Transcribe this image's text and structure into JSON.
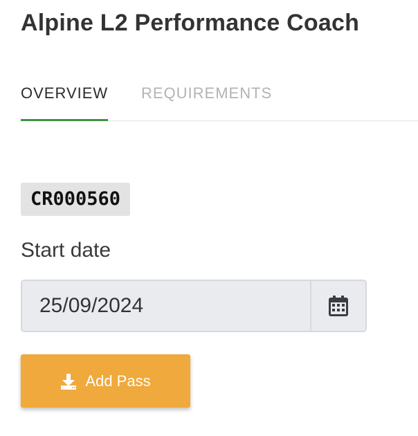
{
  "page": {
    "title": "Alpine L2 Performance Coach"
  },
  "tabs": [
    {
      "label": "OVERVIEW",
      "active": true
    },
    {
      "label": "REQUIREMENTS",
      "active": false
    }
  ],
  "course": {
    "code": "CR000560"
  },
  "start_date": {
    "label": "Start date",
    "value": "25/09/2024",
    "icon": "calendar-icon"
  },
  "actions": {
    "add_pass_label": "Add Pass",
    "add_pass_icon": "download-icon"
  },
  "colors": {
    "accent_tab": "#3d9140",
    "button_bg": "#f0a93c",
    "badge_bg": "#e3e3e3",
    "input_bg": "#e9ebef"
  }
}
